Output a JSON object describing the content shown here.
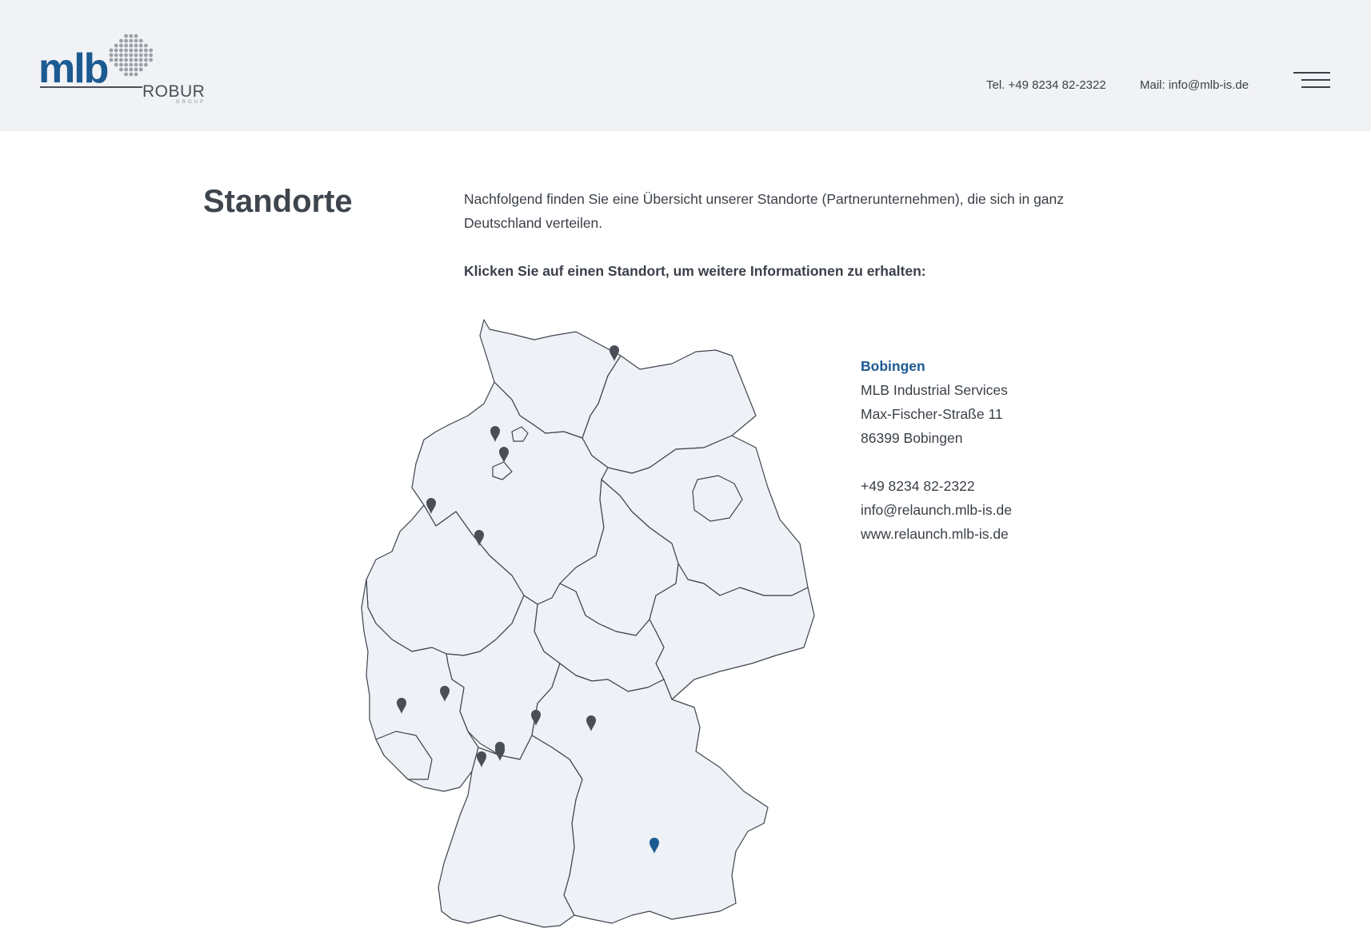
{
  "header": {
    "logo": {
      "brand": "mlb",
      "partner": "ROBUR",
      "partner_sub": "GROUP"
    },
    "tel": "Tel. +49 8234 82-2322",
    "mail": "Mail: info@mlb-is.de",
    "menu_icon": "hamburger-icon"
  },
  "main": {
    "title": "Standorte",
    "intro": "Nachfolgend finden Sie eine Übersicht unserer Standorte (Partnerunternehmen), die sich in ganz Deutschland verteilen.",
    "cta": "Klicken Sie auf einen Standort, um weitere Informationen zu erhalten:"
  },
  "map": {
    "country": "Germany",
    "pins": [
      {
        "id": "north-east-coast",
        "active": false
      },
      {
        "id": "north-west-1",
        "active": false
      },
      {
        "id": "north-west-2",
        "active": false
      },
      {
        "id": "west-1",
        "active": false
      },
      {
        "id": "west-2",
        "active": false
      },
      {
        "id": "south-west-1",
        "active": false
      },
      {
        "id": "south-west-2",
        "active": false
      },
      {
        "id": "south-west-3",
        "active": false
      },
      {
        "id": "south-west-4",
        "active": false
      },
      {
        "id": "south-west-5",
        "active": false
      },
      {
        "id": "central-south-1",
        "active": false
      },
      {
        "id": "central-south-2",
        "active": false
      },
      {
        "id": "bobingen",
        "active": true
      }
    ]
  },
  "selected_location": {
    "name": "Bobingen",
    "company": "MLB Industrial Services",
    "street": "Max-Fischer-Straße 11",
    "city": "86399 Bobingen",
    "phone": "+49 8234 82-2322",
    "email": "info@relaunch.mlb-is.de",
    "website": "www.relaunch.mlb-is.de"
  },
  "colors": {
    "accent": "#1c5a92",
    "header_bg": "#f1f2f5",
    "map_fill": "#eef1f6",
    "map_stroke": "#3f454d",
    "pin": "#4a4f57",
    "pin_active": "#1c5a92"
  }
}
